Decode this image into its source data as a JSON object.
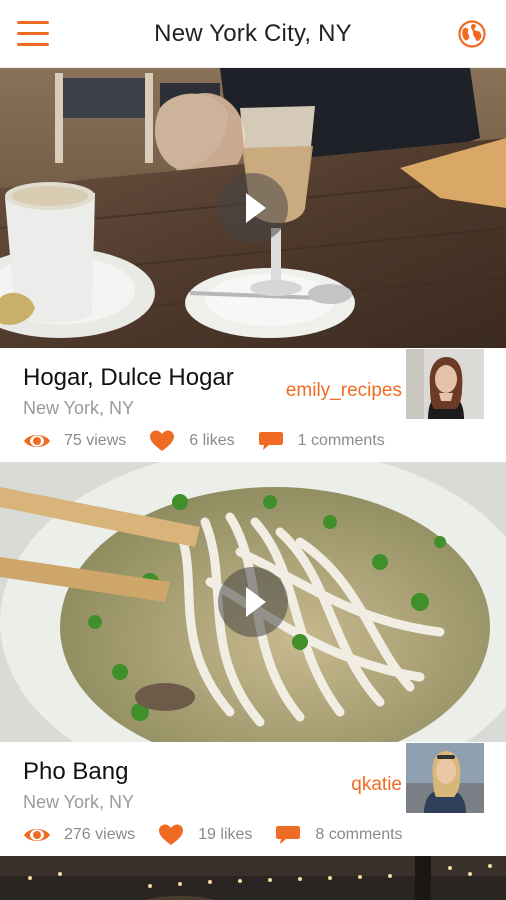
{
  "header": {
    "title": "New York City, NY",
    "menu_icon": "hamburger-menu-icon",
    "globe_icon": "globe-icon"
  },
  "colors": {
    "accent": "#ef6b23",
    "muted": "#9a9a9a"
  },
  "posts": [
    {
      "name": "Hogar, Dulce Hogar",
      "location": "New York, NY",
      "user": "emily_recipes",
      "views": "75 views",
      "likes": "6 likes",
      "comments": "1 comments"
    },
    {
      "name": "Pho Bang",
      "location": "New York, NY",
      "user": "qkatie",
      "views": "276 views",
      "likes": "19 likes",
      "comments": "8 comments"
    }
  ]
}
